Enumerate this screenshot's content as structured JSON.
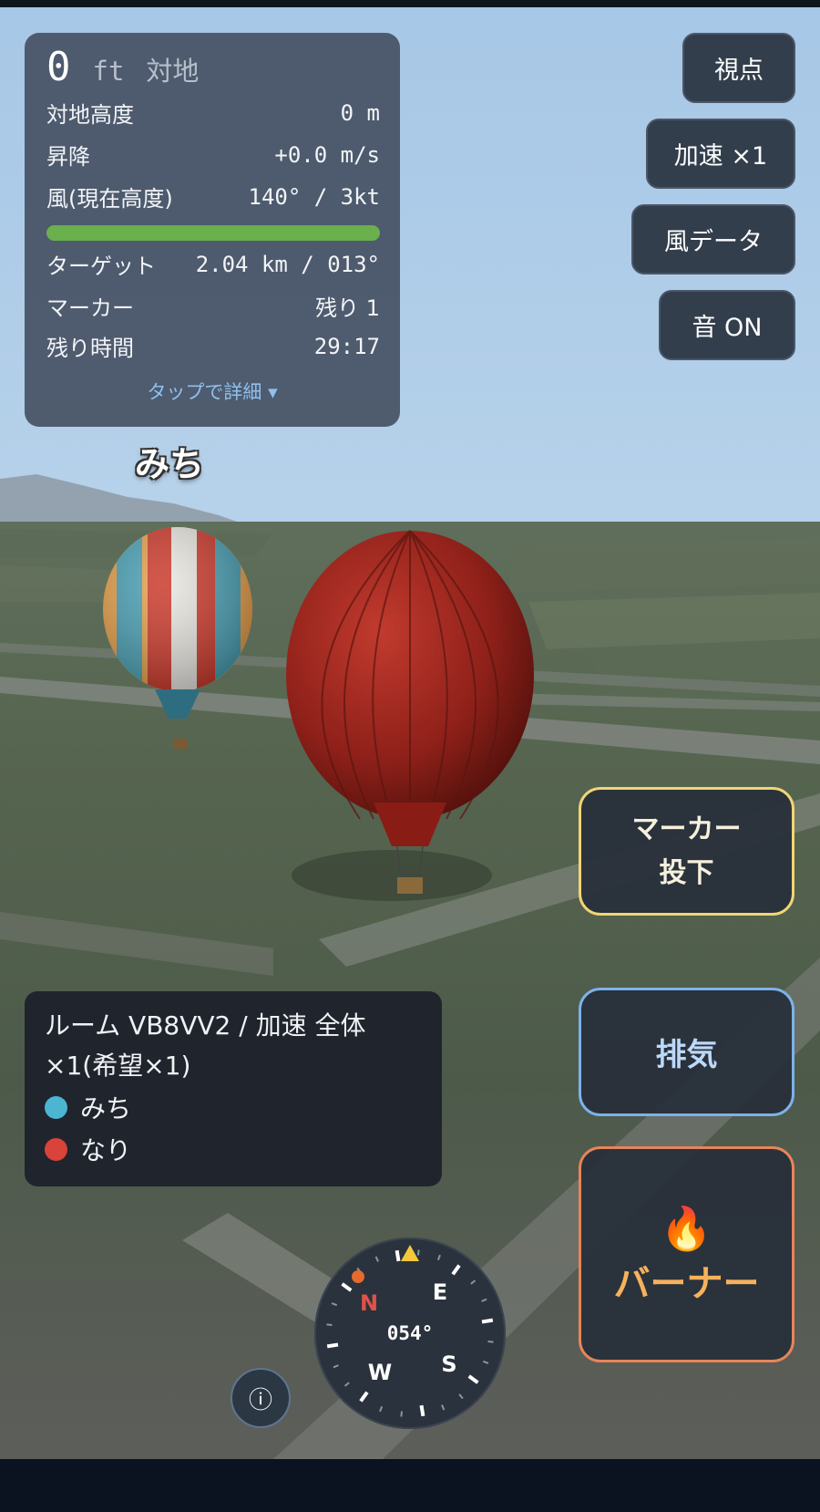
{
  "hud": {
    "altitude_ft": "0",
    "altitude_unit": "ft",
    "altitude_ref": "対地",
    "rows": [
      {
        "label": "対地高度",
        "value": "0 m"
      },
      {
        "label": "昇降",
        "value": "+0.0 m/s"
      },
      {
        "label": "風(現在高度)",
        "value": "140° / 3kt"
      }
    ],
    "progress_fraction": 1.0,
    "rows2": [
      {
        "label": "ターゲット",
        "value": "2.04 km / 013°"
      },
      {
        "label": "マーカー",
        "value": "残り 1"
      },
      {
        "label": "残り時間",
        "value": "29:17"
      }
    ],
    "tap_detail": "タップで詳細 ▾"
  },
  "buttons": {
    "viewpoint": "視点",
    "speed": "加速 ×1",
    "wind_data": "風データ",
    "sound": "音 ON",
    "marker_drop_line1": "マーカー",
    "marker_drop_line2": "投下",
    "exhaust": "排気",
    "burner_icon": "🔥",
    "burner": "バーナー",
    "info_icon": "ⓘ"
  },
  "world": {
    "player_label": "みち"
  },
  "room": {
    "title": "ルーム VB8VV2 / 加速 全体 ×1(希望×1)",
    "players": [
      {
        "name": "みち",
        "color": "#4bb5d2"
      },
      {
        "name": "なり",
        "color": "#d9433a"
      }
    ]
  },
  "compass": {
    "heading": "054°",
    "labels": {
      "n": "N",
      "e": "E",
      "s": "S",
      "w": "W"
    }
  },
  "colors": {
    "progress": "#6ab04c",
    "marker_border": "#f1d575",
    "exhaust_border": "#7db1ea",
    "burner_border": "#e8845a"
  }
}
